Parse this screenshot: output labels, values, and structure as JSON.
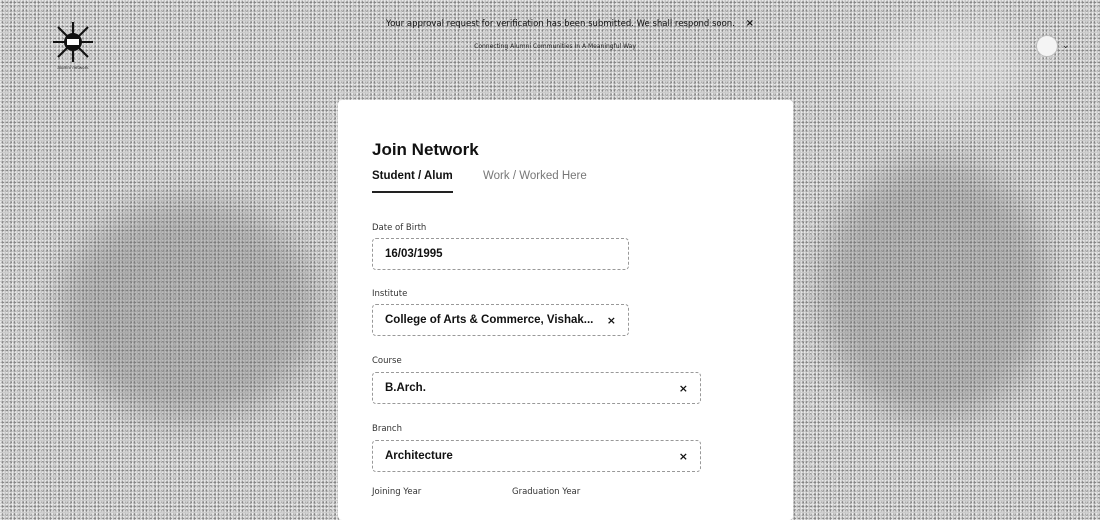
{
  "banner": {
    "message": "Your approval request for verification has been submitted. We shall respond soon.",
    "close_symbol": "×"
  },
  "tagline": "Connecting Alumni Communities In A Meaningful Way",
  "logo": {
    "icon": "starburst-logo-icon",
    "caption": "alumni network"
  },
  "user_menu": {
    "chevron": "⌄"
  },
  "form": {
    "title": "Join Network",
    "tabs": [
      {
        "label": "Student / Alum",
        "active": true
      },
      {
        "label": "Work / Worked Here",
        "active": false
      }
    ],
    "fields": {
      "dob": {
        "label": "Date of Birth",
        "value": "16/03/1995"
      },
      "institute": {
        "label": "Institute",
        "value": "College of Arts & Commerce, Vishak...",
        "clear": "×"
      },
      "course": {
        "label": "Course",
        "value": "B.Arch.",
        "clear": "×"
      },
      "branch": {
        "label": "Branch",
        "value": "Architecture",
        "clear": "×"
      },
      "joining_year": {
        "label": "Joining Year"
      },
      "graduation_year": {
        "label": "Graduation Year"
      }
    }
  },
  "colors": {
    "card": "#ffffff",
    "background": "#c9c9c9",
    "text": "#111111"
  }
}
